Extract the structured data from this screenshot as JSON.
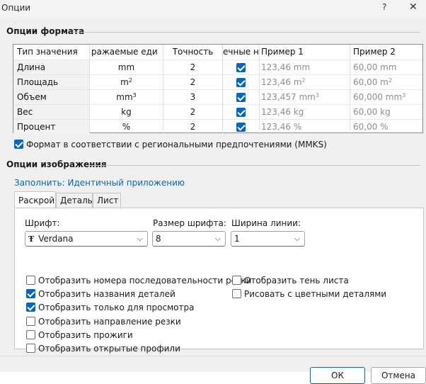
{
  "window": {
    "title": "Опции",
    "help_label": "?",
    "close_label": "✕"
  },
  "format_options": {
    "title": "Опции формата",
    "columns": [
      "Тип значения",
      "ражаемые еди",
      "Точность",
      "ечные н",
      "Пример 1",
      "Пример 2"
    ],
    "rows": [
      {
        "name": "Длина",
        "unit": "mm",
        "unit_sup": "",
        "precision": "2",
        "trailing": true,
        "ex1": "123,46 mm",
        "ex1_sup": "",
        "ex2": "60,00 mm",
        "ex2_sup": ""
      },
      {
        "name": "Площадь",
        "unit": "m",
        "unit_sup": "2",
        "precision": "2",
        "trailing": true,
        "ex1": "123,46 m",
        "ex1_sup": "2",
        "ex2": "60,00 m",
        "ex2_sup": "2"
      },
      {
        "name": "Объем",
        "unit": "mm",
        "unit_sup": "3",
        "precision": "3",
        "trailing": true,
        "ex1": "123,457 mm",
        "ex1_sup": "3",
        "ex2": "60,000 mm",
        "ex2_sup": "3"
      },
      {
        "name": "Вес",
        "unit": "kg",
        "unit_sup": "",
        "precision": "2",
        "trailing": true,
        "ex1": "123,46 kg",
        "ex1_sup": "",
        "ex2": "60,00 kg",
        "ex2_sup": ""
      },
      {
        "name": "Процент",
        "unit": "%",
        "unit_sup": "",
        "precision": "2",
        "trailing": true,
        "ex1": "123,46 %",
        "ex1_sup": "",
        "ex2": "60,00 %",
        "ex2_sup": ""
      }
    ],
    "regional_label": "Формат в соответствии с региональными предпочтениями (MMKS)",
    "regional_checked": true
  },
  "image_options": {
    "title": "Опции изображения",
    "fill_link": "Заполнить: Идентичный приложению",
    "tabs": [
      "Раскрой",
      "Деталь",
      "Лист"
    ],
    "active_tab": 0,
    "font_label": "Шрифт:",
    "font_value": "Verdana",
    "font_icon": "Ŧ",
    "font_size_label": "Размер шрифта:",
    "font_size_value": "8",
    "line_width_label": "Ширина линии:",
    "line_width_value": "1",
    "dropdown_arrow": "⌵",
    "checkboxes_left": [
      {
        "label": "Отобразить номера последовательности резки",
        "checked": false
      },
      {
        "label": "Отобразить названия деталей",
        "checked": true
      },
      {
        "label": "Отобразить только для просмотра",
        "checked": true
      },
      {
        "label": "Отобразить направление резки",
        "checked": false
      },
      {
        "label": "Отобразить прожиги",
        "checked": false
      },
      {
        "label": "Отобразить открытые профили",
        "checked": false
      }
    ],
    "checkboxes_right": [
      {
        "label": "Отобразить тень листа",
        "checked": false
      },
      {
        "label": "Рисовать с цветными деталями",
        "checked": false
      }
    ]
  },
  "footer": {
    "ok_label": "ОК",
    "cancel_label": "Отмена"
  },
  "colors": {
    "accent": "#0067c0",
    "background": "#f0f0f0"
  }
}
